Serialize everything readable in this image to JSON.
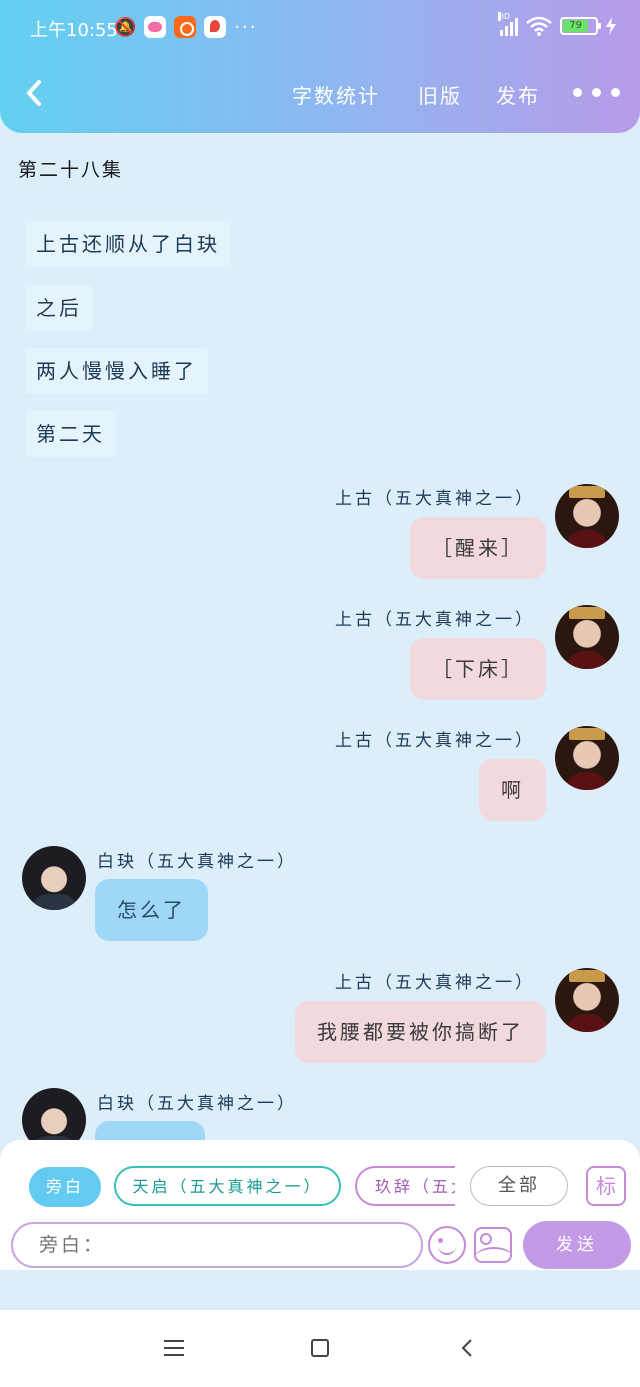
{
  "status_bar": {
    "time": "上午10:55",
    "battery": "79",
    "network": "HD"
  },
  "toolbar": {
    "word_count": "字数统计",
    "old_version": "旧版",
    "publish": "发布"
  },
  "chapter_title": "第二十八集",
  "narration": [
    "上古还顺从了白玦",
    "之后",
    "两人慢慢入睡了",
    "第二天"
  ],
  "messages": [
    {
      "speaker": "上古（五大真神之一）",
      "text": "［醒来］",
      "side": "right"
    },
    {
      "speaker": "上古（五大真神之一）",
      "text": "［下床］",
      "side": "right"
    },
    {
      "speaker": "上古（五大真神之一）",
      "text": "啊",
      "side": "right"
    },
    {
      "speaker": "白玦（五大真神之一）",
      "text": "怎么了",
      "side": "left"
    },
    {
      "speaker": "上古（五大真神之一）",
      "text": "我腰都要被你搞断了",
      "side": "right"
    },
    {
      "speaker": "白玦（五大真神之一）",
      "text": "",
      "side": "left"
    }
  ],
  "role_chips": [
    "旁白",
    "天启（五大真神之一）",
    "玖辞（五大真神之一）",
    "全部"
  ],
  "tag_button": "标",
  "input": {
    "placeholder": "旁白："
  },
  "send_label": "发送",
  "colors": {
    "accent_blue": "#63cbf1",
    "accent_purple": "#c39ae6",
    "bubble_right": "#f1d9de",
    "bubble_left": "#9fd8f6"
  }
}
